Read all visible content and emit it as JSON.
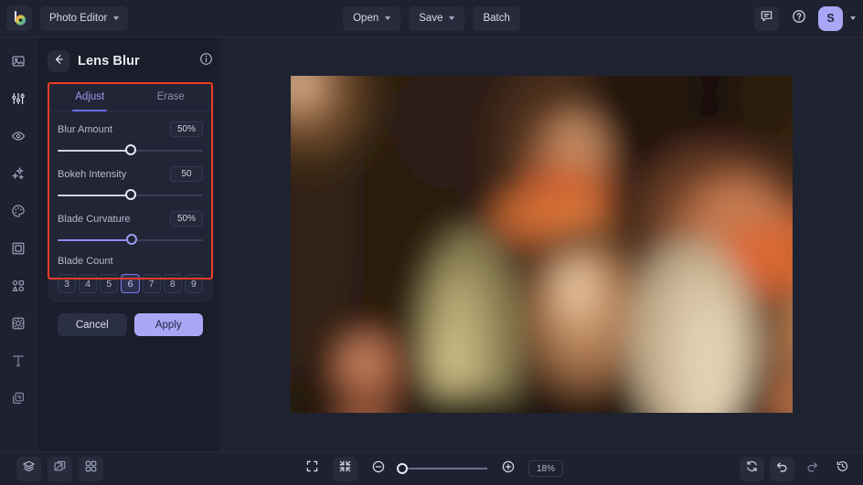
{
  "topbar": {
    "logo_icon": "app-logo-color-wheel",
    "app_menu_label": "Photo Editor",
    "open_label": "Open",
    "save_label": "Save",
    "batch_label": "Batch",
    "feedback_icon": "comment-icon",
    "help_icon": "question-circle-icon",
    "avatar_initial": "S"
  },
  "rail": {
    "items": [
      {
        "icon": "image-icon",
        "active": false
      },
      {
        "icon": "adjustments-sliders-icon",
        "active": false
      },
      {
        "icon": "eye-icon",
        "active": false
      },
      {
        "icon": "sparkles-effects-icon",
        "active": false
      },
      {
        "icon": "color-palette-icon",
        "active": false
      },
      {
        "icon": "frame-border-icon",
        "active": false
      },
      {
        "icon": "shapes-icon",
        "active": false
      },
      {
        "icon": "blur-filter-icon",
        "active": false
      },
      {
        "icon": "text-type-icon",
        "active": false
      },
      {
        "icon": "layers-stack-icon",
        "active": false
      }
    ]
  },
  "panel": {
    "back_icon": "arrow-left-icon",
    "title": "Lens Blur",
    "info_icon": "info-circle-icon",
    "tabs": [
      {
        "label": "Adjust",
        "active": true
      },
      {
        "label": "Erase",
        "active": false
      }
    ],
    "sliders": [
      {
        "label": "Blur Amount",
        "value": "50%",
        "percent": 50,
        "accent": false
      },
      {
        "label": "Bokeh Intensity",
        "value": "50",
        "percent": 50,
        "accent": false
      },
      {
        "label": "Blade Curvature",
        "value": "50%",
        "percent": 51,
        "accent": true
      }
    ],
    "blade_count": {
      "label": "Blade Count",
      "options": [
        "3",
        "4",
        "5",
        "6",
        "7",
        "8",
        "9"
      ],
      "selected": "6"
    },
    "cancel_label": "Cancel",
    "apply_label": "Apply",
    "highlight_color": "#ee3d23"
  },
  "bottombar": {
    "layers_icon": "layers-icon",
    "compare_icon": "compare-split-icon",
    "grid_icon": "grid-view-icon",
    "fit_screen_icon": "fit-to-screen-icon",
    "actual_size_icon": "shrink-to-fit-icon",
    "zoom_out_icon": "zoom-out-minus-icon",
    "zoom_in_icon": "zoom-in-plus-icon",
    "zoom_value": "18%",
    "reset_icon": "reset-refresh-icon",
    "undo_icon": "undo-arrow-icon",
    "redo_icon": "redo-arrow-icon",
    "history_icon": "history-clock-icon"
  },
  "canvas": {
    "image_description": "blurred-warm-portrait-bokeh"
  },
  "colors": {
    "accent": "#a9a7f5",
    "accent_text": "#9b9bf0",
    "panel_bg": "#222536",
    "app_bg": "#1b1d2a",
    "bar_bg": "#1e2130"
  }
}
